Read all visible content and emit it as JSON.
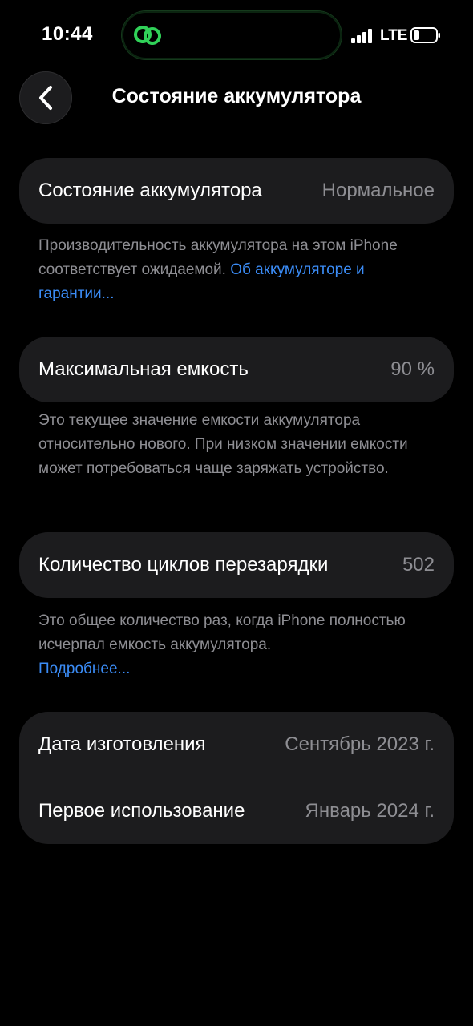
{
  "status_bar": {
    "time": "10:44",
    "network": "LTE",
    "icons": [
      "green-link-activity-icon",
      "cellular-signal-icon",
      "battery-low-icon"
    ]
  },
  "nav": {
    "title": "Состояние аккумулятора",
    "back_icon": "chevron-left-icon"
  },
  "battery_health": {
    "label": "Состояние аккумулятора",
    "value": "Нормальное",
    "footnote": "Производительность аккумулятора на этом iPhone соответствует ожидаемой.",
    "link_text": "Об аккумуляторе и гарантии..."
  },
  "max_capacity": {
    "label": "Максимальная емкость",
    "value": "90 %",
    "footnote": "Это текущее значение емкости аккумулятора относительно нового. При низком значении емкости может потребоваться чаще заряжать устройство."
  },
  "cycle_count": {
    "label": "Количество циклов перезарядки",
    "value": "502",
    "footnote": "Это общее количество раз, когда iPhone полностью исчерпал емкость аккумулятора.",
    "link_text": "Подробнее..."
  },
  "dates": {
    "manufacture_label": "Дата изготовления",
    "manufacture_value": "Сентябрь 2023 г.",
    "first_use_label": "Первое использование",
    "first_use_value": "Январь 2024 г."
  },
  "colors": {
    "background": "#000000",
    "card": "#1c1c1e",
    "secondary_text": "#8e8e93",
    "link": "#3b8cf6",
    "accent_green": "#30d158"
  }
}
